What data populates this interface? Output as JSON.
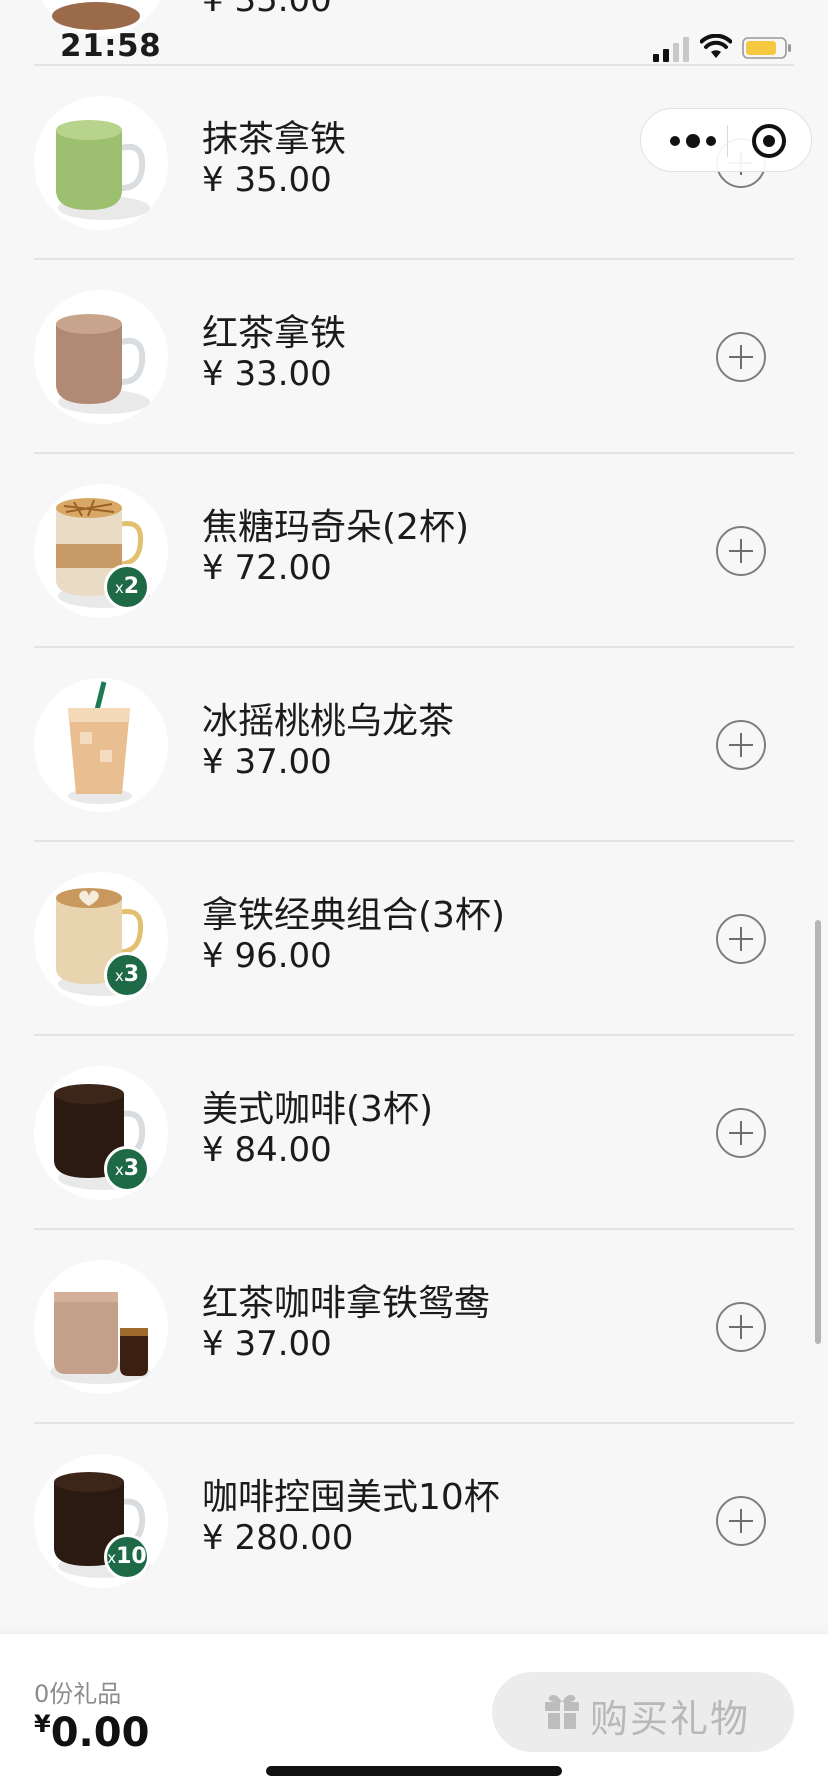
{
  "status_bar": {
    "time": "21:58",
    "icons": [
      "cellular-signal-icon",
      "wifi-icon",
      "battery-icon"
    ],
    "battery_color": "#f5c842"
  },
  "capsule": {
    "icons": [
      "more-icon",
      "close-miniprogram-icon"
    ]
  },
  "partial_item": {
    "price": "¥ 35.00"
  },
  "products": [
    {
      "name": "抹茶拿铁",
      "price": "¥ 35.00",
      "icon": "matcha-latte-mug",
      "badge": null
    },
    {
      "name": "红茶拿铁",
      "price": "¥ 33.00",
      "icon": "black-tea-latte-mug",
      "badge": null
    },
    {
      "name": "焦糖玛奇朵(2杯)",
      "price": "¥ 72.00",
      "icon": "caramel-macchiato-glass",
      "badge": "2"
    },
    {
      "name": "冰摇桃桃乌龙茶",
      "price": "¥ 37.00",
      "icon": "iced-peach-oolong-cup",
      "badge": null
    },
    {
      "name": "拿铁经典组合(3杯)",
      "price": "¥ 96.00",
      "icon": "latte-art-mug",
      "badge": "3"
    },
    {
      "name": "美式咖啡(3杯)",
      "price": "¥ 84.00",
      "icon": "americano-mug",
      "badge": "3"
    },
    {
      "name": "红茶咖啡拿铁鸳鸯",
      "price": "¥ 37.00",
      "icon": "tea-coffee-duo",
      "badge": null
    },
    {
      "name": "咖啡控囤美式10杯",
      "price": "¥ 280.00",
      "icon": "americano-mug",
      "badge": "10"
    }
  ],
  "bottom_bar": {
    "gift_count": "0份礼品",
    "currency": "¥",
    "total": "0.00",
    "buy_button_label": "购买礼物",
    "buy_button_icon": "gift-icon"
  },
  "colors": {
    "background": "#f7f7f7",
    "badge": "#1e6a47",
    "divider": "#e3e3e3",
    "button_disabled_bg": "#ececec",
    "button_disabled_text": "#b8b8b8"
  }
}
